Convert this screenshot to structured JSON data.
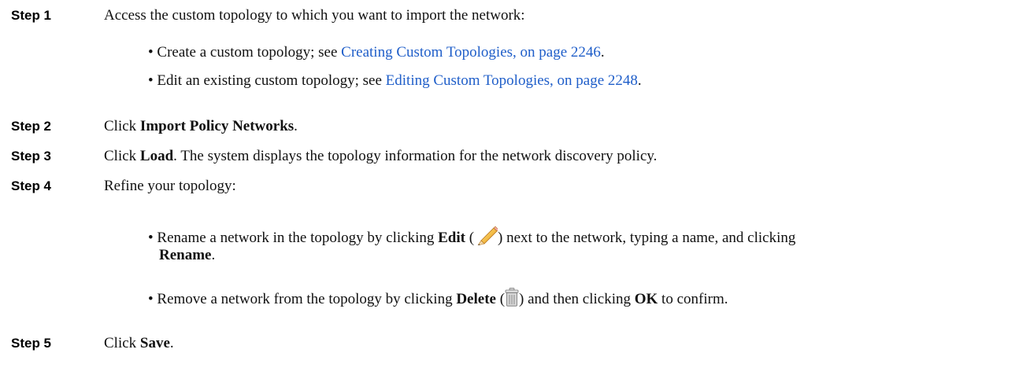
{
  "steps": [
    {
      "label": "Step 1",
      "text": "Access the custom topology to which you want to import the network:",
      "bullets": [
        {
          "bullet": "•",
          "before": "Create a custom topology; see ",
          "link": "Creating Custom Topologies, on page 2246",
          "after": "."
        },
        {
          "bullet": "•",
          "before": "Edit an existing custom topology; see ",
          "link": "Editing Custom Topologies, on page 2248",
          "after": "."
        }
      ]
    },
    {
      "label": "Step 2",
      "pre": "Click ",
      "bold": "Import Policy Networks",
      "post": "."
    },
    {
      "label": "Step 3",
      "pre": "Click ",
      "bold": "Load",
      "post": ". The system displays the topology information for the network discovery policy."
    },
    {
      "label": "Step 4",
      "text": "Refine your topology:",
      "bullets": [
        {
          "bullet": "•",
          "t1": "Rename a network in the topology by clicking ",
          "b1": "Edit",
          "t2": " (",
          "icon": "pencil-icon",
          "t3": ") next to the network, typing a name, and clicking",
          "b2": "Rename",
          "t4": "."
        },
        {
          "bullet": "•",
          "t1": "Remove a network from the topology by clicking ",
          "b1": "Delete",
          "t2": " (",
          "icon": "trash-icon",
          "t3": ") and then clicking ",
          "b2": "OK",
          "t4": " to confirm."
        }
      ]
    },
    {
      "label": "Step 5",
      "pre": "Click ",
      "bold": "Save",
      "post": "."
    }
  ]
}
